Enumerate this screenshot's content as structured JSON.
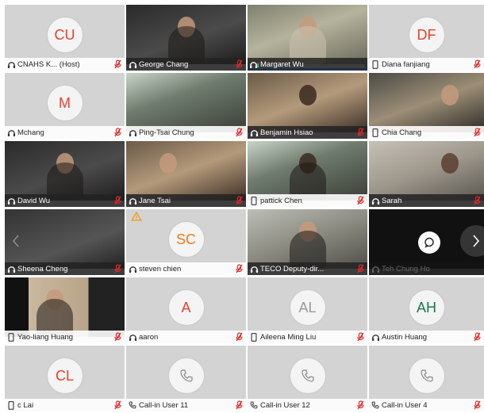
{
  "colors": {
    "mic_off": "#e02828",
    "accent": "#2d8cff",
    "avatar_initials": "#e8402a",
    "avatar_initials_alt": "#999999"
  },
  "tiles": [
    {
      "name": "CNAHS K...     (Host)",
      "type": "avatar",
      "initials": "CU",
      "device": "headphone",
      "muted": true
    },
    {
      "name": "George Chang",
      "type": "video",
      "device": "headphone",
      "muted": true
    },
    {
      "name": "Margaret Wu",
      "type": "video",
      "device": "headphone",
      "muted": false,
      "active": true
    },
    {
      "name": "Diana fanjiang",
      "type": "avatar",
      "initials": "DF",
      "device": "phone",
      "muted": true
    },
    {
      "name": "Mchang",
      "type": "avatar",
      "initials": "M",
      "device": "headphone",
      "muted": true
    },
    {
      "name": "Ping-Tsai Chung",
      "type": "video",
      "device": "headphone",
      "muted": true
    },
    {
      "name": "Benjamin Hsiao",
      "type": "video",
      "device": "headphone",
      "muted": true
    },
    {
      "name": "Chia Chang",
      "type": "video",
      "device": "phone",
      "muted": true
    },
    {
      "name": "David Wu",
      "type": "video",
      "device": "headphone",
      "muted": true
    },
    {
      "name": "Jane Tsai",
      "type": "video",
      "device": "headphone",
      "muted": true
    },
    {
      "name": "pattick Chen",
      "type": "video",
      "device": "phone",
      "muted": true
    },
    {
      "name": "Sarah",
      "type": "video",
      "device": "headphone",
      "muted": true
    },
    {
      "name": "Sheena Cheng",
      "type": "video",
      "device": "headphone",
      "muted": true
    },
    {
      "name": "steven chien",
      "type": "avatar",
      "initials": "SC",
      "device": "headphone",
      "muted": true,
      "warning": true
    },
    {
      "name": "TECO Deputy-dir...",
      "type": "video",
      "device": "headphone",
      "muted": true
    },
    {
      "name": "Teh Chung Ho",
      "type": "video",
      "device": "headphone",
      "muted": false
    },
    {
      "name": "Yao-liang Huang",
      "type": "video",
      "device": "phone",
      "muted": true
    },
    {
      "name": "aaron",
      "type": "avatar",
      "initials": "A",
      "device": "headphone",
      "muted": true
    },
    {
      "name": "Aileena Ming Liu",
      "type": "avatar",
      "initials": "AL",
      "device": "phone",
      "muted": true
    },
    {
      "name": "Austin Huang",
      "type": "avatar",
      "initials": "AH",
      "device": "headphone",
      "muted": true
    },
    {
      "name": "c Lai",
      "type": "avatar",
      "initials": "CL",
      "device": "phone",
      "muted": true
    },
    {
      "name": "Call-in User 11",
      "type": "callin",
      "device": "call",
      "muted": true
    },
    {
      "name": "Call-in User 12",
      "type": "callin",
      "device": "call",
      "muted": true
    },
    {
      "name": "Call-in User 4",
      "type": "callin",
      "device": "call",
      "muted": true
    }
  ]
}
